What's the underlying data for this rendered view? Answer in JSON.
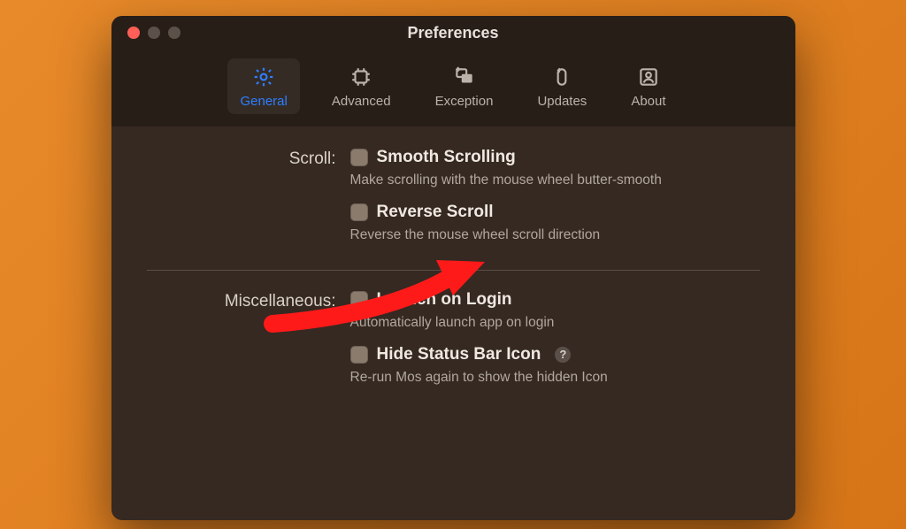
{
  "window": {
    "title": "Preferences"
  },
  "tabs": {
    "general": {
      "label": "General"
    },
    "advanced": {
      "label": "Advanced"
    },
    "exception": {
      "label": "Exception"
    },
    "updates": {
      "label": "Updates"
    },
    "about": {
      "label": "About"
    }
  },
  "sections": {
    "scroll": {
      "label": "Scroll:",
      "smooth": {
        "title": "Smooth Scrolling",
        "desc": "Make scrolling with the mouse wheel butter-smooth"
      },
      "reverse": {
        "title": "Reverse Scroll",
        "desc": "Reverse the mouse wheel scroll direction"
      }
    },
    "misc": {
      "label": "Miscellaneous:",
      "launch": {
        "title": "Launch on Login",
        "desc": "Automatically launch app on login"
      },
      "hide": {
        "title": "Hide Status Bar Icon",
        "desc": "Re-run Mos again to show the hidden Icon",
        "help": "?"
      }
    }
  }
}
